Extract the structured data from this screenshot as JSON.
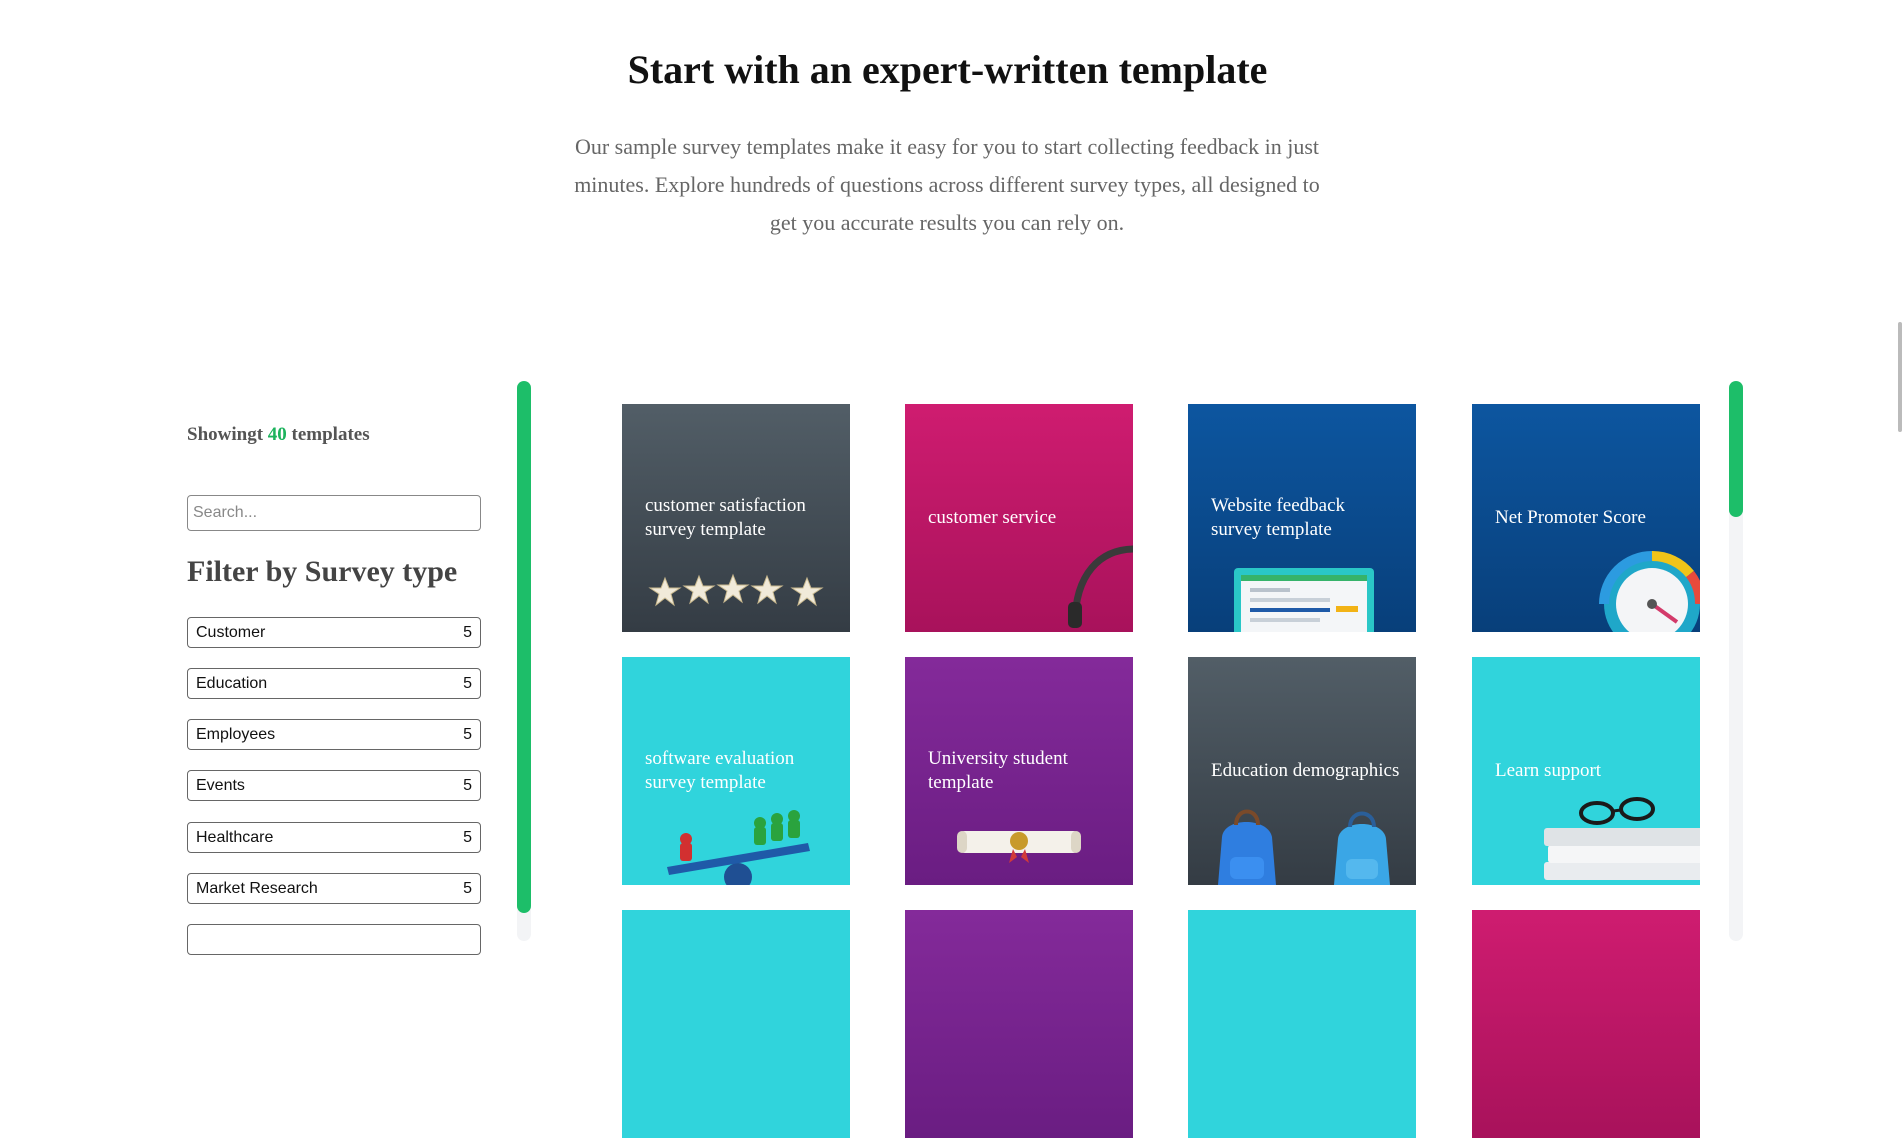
{
  "hero": {
    "title": "Start with an expert-written template",
    "subtitle": "Our sample survey templates make it easy for you to start collecting feedback in just minutes. Explore hundreds of questions across different survey types, all designed to get you accurate results you can rely on."
  },
  "sidebar": {
    "count_prefix": "Showingt",
    "count": "40",
    "count_suffix": "templates",
    "search_placeholder": "Search...",
    "filter_heading": "Filter by Survey type",
    "filters": [
      {
        "label": "Customer",
        "count": "5"
      },
      {
        "label": "Education",
        "count": "5"
      },
      {
        "label": "Employees",
        "count": "5"
      },
      {
        "label": "Events",
        "count": "5"
      },
      {
        "label": "Healthcare",
        "count": "5"
      },
      {
        "label": "Market Research",
        "count": "5"
      }
    ]
  },
  "templates": [
    {
      "title": "customer satisfaction survey template",
      "color": "#3f4a53",
      "icon": "five-stars-icon"
    },
    {
      "title": "customer service",
      "color": "#c81a6b",
      "icon": "headset-icon"
    },
    {
      "title": "Website feedback survey template",
      "color": "#0b4c90",
      "icon": "monitor-icon"
    },
    {
      "title": "Net Promoter Score",
      "color": "#0b4c90",
      "icon": "gauge-icon"
    },
    {
      "title": "software evaluation survey template",
      "color": "#30d4dc",
      "icon": "seesaw-icon"
    },
    {
      "title": "University student template",
      "color": "#7a2590",
      "icon": "diploma-icon"
    },
    {
      "title": "Education demographics",
      "color": "#3f4a53",
      "icon": "backpacks-icon"
    },
    {
      "title": "Learn support",
      "color": "#30d4dc",
      "icon": "books-glasses-icon"
    },
    {
      "title": "",
      "color": "#30d4dc",
      "icon": ""
    },
    {
      "title": "",
      "color": "#7a2590",
      "icon": ""
    },
    {
      "title": "",
      "color": "#30d4dc",
      "icon": ""
    },
    {
      "title": "",
      "color": "#c81a6b",
      "icon": ""
    }
  ],
  "colors": {
    "accent": "#1dbe69",
    "count_green": "#1db35d"
  }
}
